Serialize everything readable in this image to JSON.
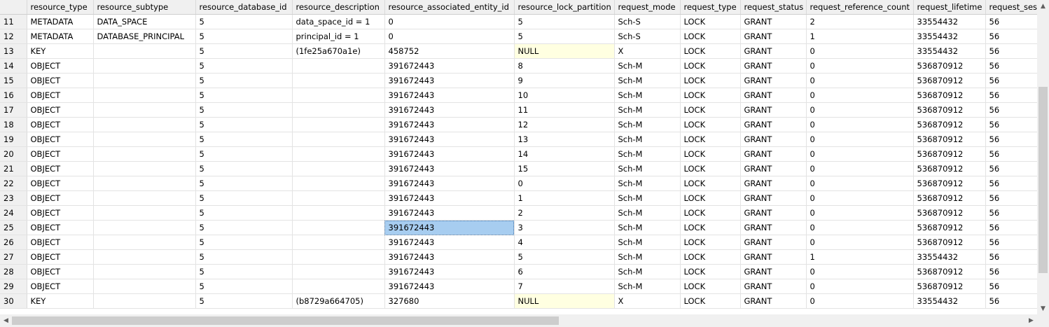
{
  "columns": [
    "",
    "resource_type",
    "resource_subtype",
    "resource_database_id",
    "resource_description",
    "resource_associated_entity_id",
    "resource_lock_partition",
    "request_mode",
    "request_type",
    "request_status",
    "request_reference_count",
    "request_lifetime",
    "request_ses"
  ],
  "rows": [
    [
      "11",
      "METADATA",
      "DATA_SPACE",
      "5",
      "data_space_id = 1",
      "0",
      "5",
      "Sch-S",
      "LOCK",
      "GRANT",
      "2",
      "33554432",
      "56"
    ],
    [
      "12",
      "METADATA",
      "DATABASE_PRINCIPAL",
      "5",
      "principal_id = 1",
      "0",
      "5",
      "Sch-S",
      "LOCK",
      "GRANT",
      "1",
      "33554432",
      "56"
    ],
    [
      "13",
      "KEY",
      "",
      "5",
      "(1fe25a670a1e)",
      "458752",
      "NULL",
      "X",
      "LOCK",
      "GRANT",
      "0",
      "33554432",
      "56"
    ],
    [
      "14",
      "OBJECT",
      "",
      "5",
      "",
      "391672443",
      "8",
      "Sch-M",
      "LOCK",
      "GRANT",
      "0",
      "536870912",
      "56"
    ],
    [
      "15",
      "OBJECT",
      "",
      "5",
      "",
      "391672443",
      "9",
      "Sch-M",
      "LOCK",
      "GRANT",
      "0",
      "536870912",
      "56"
    ],
    [
      "16",
      "OBJECT",
      "",
      "5",
      "",
      "391672443",
      "10",
      "Sch-M",
      "LOCK",
      "GRANT",
      "0",
      "536870912",
      "56"
    ],
    [
      "17",
      "OBJECT",
      "",
      "5",
      "",
      "391672443",
      "11",
      "Sch-M",
      "LOCK",
      "GRANT",
      "0",
      "536870912",
      "56"
    ],
    [
      "18",
      "OBJECT",
      "",
      "5",
      "",
      "391672443",
      "12",
      "Sch-M",
      "LOCK",
      "GRANT",
      "0",
      "536870912",
      "56"
    ],
    [
      "19",
      "OBJECT",
      "",
      "5",
      "",
      "391672443",
      "13",
      "Sch-M",
      "LOCK",
      "GRANT",
      "0",
      "536870912",
      "56"
    ],
    [
      "20",
      "OBJECT",
      "",
      "5",
      "",
      "391672443",
      "14",
      "Sch-M",
      "LOCK",
      "GRANT",
      "0",
      "536870912",
      "56"
    ],
    [
      "21",
      "OBJECT",
      "",
      "5",
      "",
      "391672443",
      "15",
      "Sch-M",
      "LOCK",
      "GRANT",
      "0",
      "536870912",
      "56"
    ],
    [
      "22",
      "OBJECT",
      "",
      "5",
      "",
      "391672443",
      "0",
      "Sch-M",
      "LOCK",
      "GRANT",
      "0",
      "536870912",
      "56"
    ],
    [
      "23",
      "OBJECT",
      "",
      "5",
      "",
      "391672443",
      "1",
      "Sch-M",
      "LOCK",
      "GRANT",
      "0",
      "536870912",
      "56"
    ],
    [
      "24",
      "OBJECT",
      "",
      "5",
      "",
      "391672443",
      "2",
      "Sch-M",
      "LOCK",
      "GRANT",
      "0",
      "536870912",
      "56"
    ],
    [
      "25",
      "OBJECT",
      "",
      "5",
      "",
      "391672443",
      "3",
      "Sch-M",
      "LOCK",
      "GRANT",
      "0",
      "536870912",
      "56"
    ],
    [
      "26",
      "OBJECT",
      "",
      "5",
      "",
      "391672443",
      "4",
      "Sch-M",
      "LOCK",
      "GRANT",
      "0",
      "536870912",
      "56"
    ],
    [
      "27",
      "OBJECT",
      "",
      "5",
      "",
      "391672443",
      "5",
      "Sch-M",
      "LOCK",
      "GRANT",
      "1",
      "33554432",
      "56"
    ],
    [
      "28",
      "OBJECT",
      "",
      "5",
      "",
      "391672443",
      "6",
      "Sch-M",
      "LOCK",
      "GRANT",
      "0",
      "536870912",
      "56"
    ],
    [
      "29",
      "OBJECT",
      "",
      "5",
      "",
      "391672443",
      "7",
      "Sch-M",
      "LOCK",
      "GRANT",
      "0",
      "536870912",
      "56"
    ],
    [
      "30",
      "KEY",
      "",
      "5",
      "(b8729a664705)",
      "327680",
      "NULL",
      "X",
      "LOCK",
      "GRANT",
      "0",
      "33554432",
      "56"
    ]
  ],
  "selected_cell": {
    "row": 14,
    "col": 5
  },
  "null_text": "NULL",
  "colors": {
    "null_bg": "#ffffe1",
    "selected_bg": "#a7cdf0",
    "header_bg": "#f0f0f0",
    "grid_line": "#e3e3e3"
  },
  "scrollbars": {
    "vertical": {
      "position_fraction": 0.72,
      "visible_fraction": 0.64
    },
    "horizontal": {
      "position_fraction": 0.0,
      "visible_fraction": 0.54
    }
  }
}
